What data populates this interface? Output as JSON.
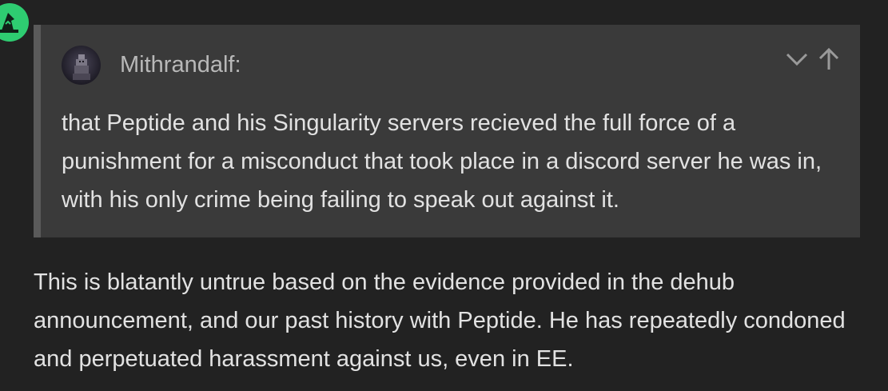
{
  "quote": {
    "author": "Mithrandalf:",
    "body": "that Peptide and his Singularity servers recieved the full force of a punishment for a misconduct that took place in a discord server he was in, with his only crime being failing to speak out against it."
  },
  "reply": {
    "body": "This is blatantly untrue based on the evidence provided in the dehub announcement, and our past history with Peptide. He has repeatedly condoned and perpetuated harassment against us, even in EE."
  },
  "icons": {
    "badge": "wizard-hat-icon",
    "expand": "chevron-down-icon",
    "jump": "arrow-up-icon"
  },
  "colors": {
    "background": "#222222",
    "quote_background": "#3a3a3a",
    "quote_border": "#5a5a5a",
    "badge": "#2ecc71",
    "text": "#e2e2e2",
    "muted_text": "#b8b8b8"
  }
}
